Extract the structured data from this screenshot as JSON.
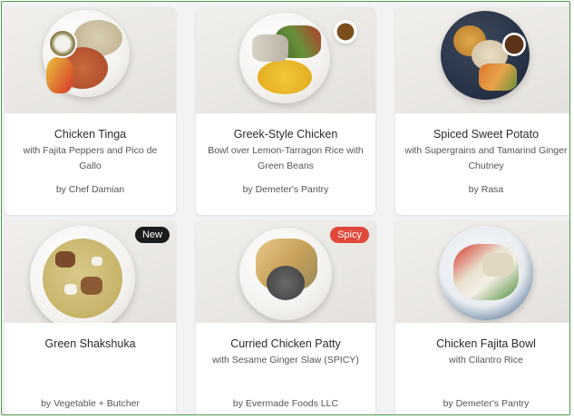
{
  "meals": [
    {
      "title": "Chicken Tinga",
      "subtitle": "with Fajita Peppers and Pico de Gallo",
      "chef": "by Chef Damian",
      "badge": ""
    },
    {
      "title": "Greek-Style Chicken",
      "subtitle": "Bowl over Lemon-Tarragon Rice with Green Beans",
      "chef": "by Demeter's Pantry",
      "badge": ""
    },
    {
      "title": "Spiced Sweet Potato",
      "subtitle": "with Supergrains and Tamarind Ginger Chutney",
      "chef": "by Rasa",
      "badge": ""
    },
    {
      "title": "Green Shakshuka",
      "subtitle": "",
      "chef": "by Vegetable + Butcher",
      "badge": "New"
    },
    {
      "title": "Curried Chicken Patty",
      "subtitle": "with Sesame Ginger Slaw (SPICY)",
      "chef": "by Evermade Foods LLC",
      "badge": "Spicy"
    },
    {
      "title": "Chicken Fajita Bowl",
      "subtitle": "with Cilantro Rice",
      "chef": "by Demeter's Pantry",
      "badge": ""
    }
  ],
  "colors": {
    "new_badge": "#1c1c1c",
    "spicy_badge": "#e0483a",
    "frame_border": "#4a9a4a"
  }
}
